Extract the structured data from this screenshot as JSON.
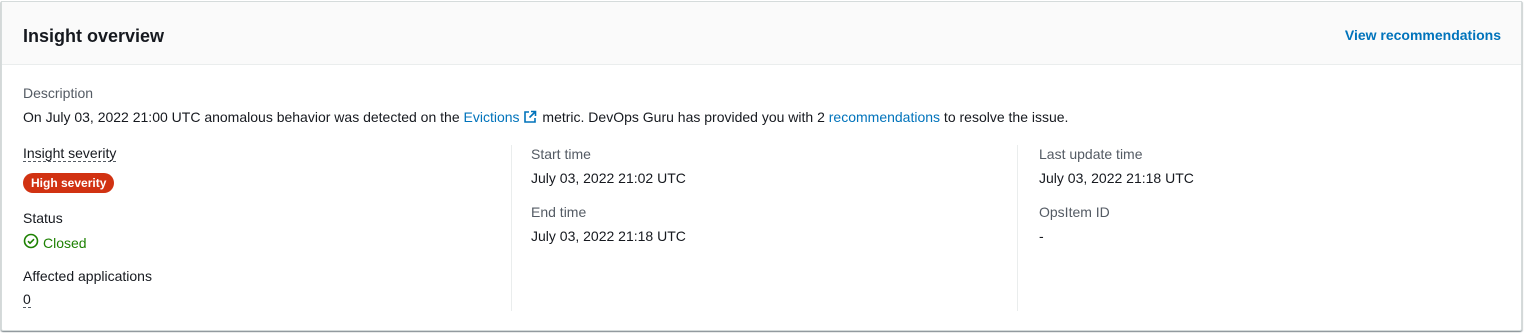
{
  "header": {
    "title": "Insight overview",
    "view_recommendations_label": "View recommendations"
  },
  "description": {
    "label": "Description",
    "text_before": "On July 03, 2022 21:00 UTC anomalous behavior was detected on the ",
    "metric_link": "Evictions",
    "text_middle": " metric. DevOps Guru has provided you with 2 ",
    "recommendations_link": "recommendations",
    "text_after": " to resolve the issue."
  },
  "severity": {
    "label": "Insight severity",
    "badge": "High severity",
    "badge_color": "#d13212"
  },
  "status": {
    "label": "Status",
    "value": "Closed",
    "icon": "check-circle-icon",
    "color": "#1d8102"
  },
  "affected_applications": {
    "label": "Affected applications",
    "value": "0"
  },
  "start_time": {
    "label": "Start time",
    "value": "July 03, 2022 21:02 UTC"
  },
  "end_time": {
    "label": "End time",
    "value": "July 03, 2022 21:18 UTC"
  },
  "last_update_time": {
    "label": "Last update time",
    "value": "July 03, 2022 21:18 UTC"
  },
  "opsitem_id": {
    "label": "OpsItem ID",
    "value": "-"
  },
  "colors": {
    "link": "#0073bb",
    "label": "#545b64",
    "text": "#16191f"
  }
}
